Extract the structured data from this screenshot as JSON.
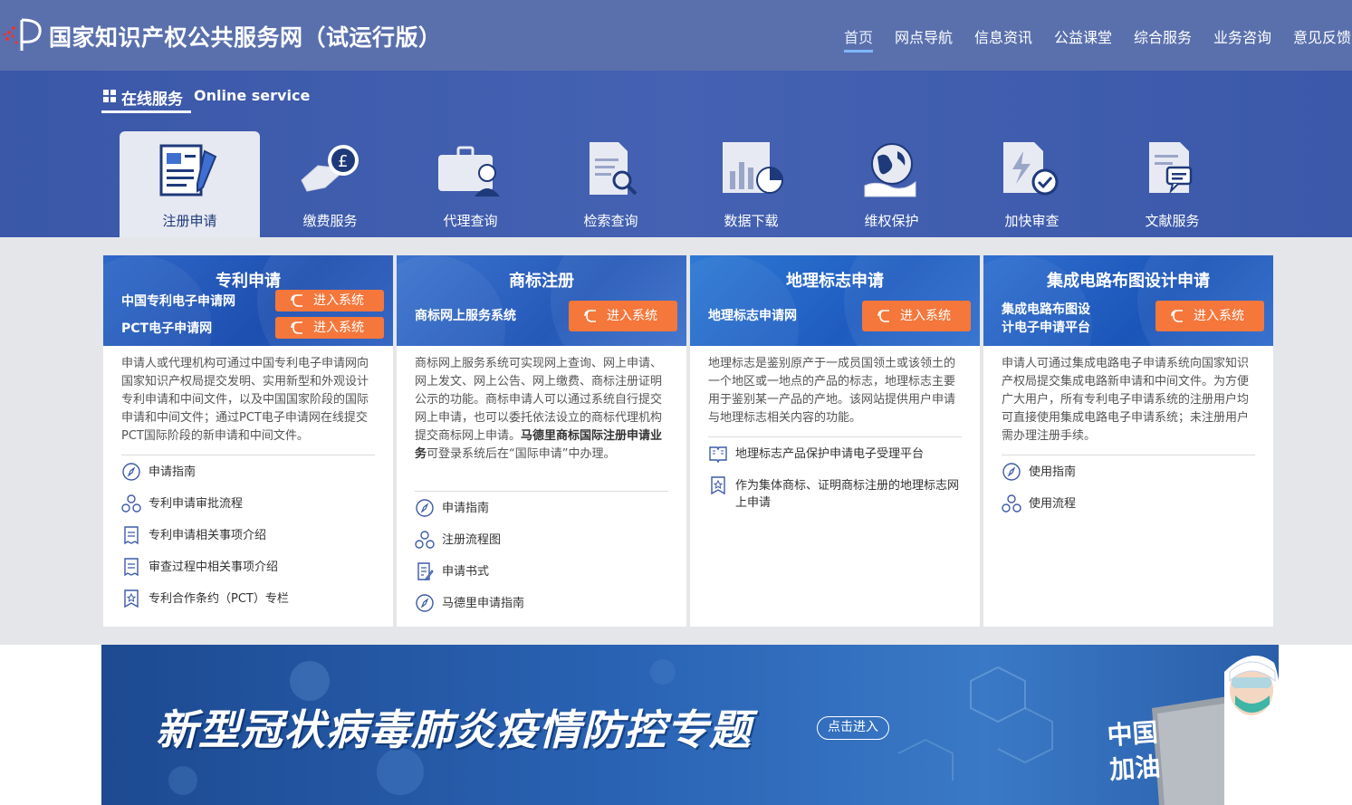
{
  "header": {
    "site_title": "国家知识产权公共服务网（试运行版）",
    "nav": [
      "首页",
      "网点导航",
      "信息资讯",
      "公益课堂",
      "综合服务",
      "业务咨询",
      "意见反馈"
    ],
    "active_nav": "首页"
  },
  "online_service": {
    "heading_cn": "在线服务",
    "heading_en": "Online service",
    "tabs": [
      {
        "label": "注册申请",
        "icon": "form-pen-icon",
        "active": true
      },
      {
        "label": "缴费服务",
        "icon": "hand-coin-icon",
        "active": false
      },
      {
        "label": "代理查询",
        "icon": "briefcase-person-icon",
        "active": false
      },
      {
        "label": "检索查询",
        "icon": "document-search-icon",
        "active": false
      },
      {
        "label": "数据下载",
        "icon": "bar-chart-icon",
        "active": false
      },
      {
        "label": "维权保护",
        "icon": "globe-hand-icon",
        "active": false
      },
      {
        "label": "加快审查",
        "icon": "lightning-check-icon",
        "active": false
      },
      {
        "label": "文献服务",
        "icon": "document-chat-icon",
        "active": false
      }
    ]
  },
  "cards": [
    {
      "title": "专利申请",
      "systems": [
        {
          "name": "中国专利电子申请网",
          "button": "进入系统"
        },
        {
          "name": "PCT电子申请网",
          "button": "进入系统"
        }
      ],
      "description": "申请人或代理机构可通过中国专利电子申请网向国家知识产权局提交发明、实用新型和外观设计专利申请和中间文件，以及中国国家阶段的国际申请和中间文件；通过PCT电子申请网在线提交PCT国际阶段的新申请和中间文件。",
      "links": [
        {
          "label": "申请指南",
          "icon": "compass-icon"
        },
        {
          "label": "专利申请审批流程",
          "icon": "flow-nodes-icon"
        },
        {
          "label": "专利申请相关事项介绍",
          "icon": "receipt-icon"
        },
        {
          "label": "审查过程中相关事项介绍",
          "icon": "receipt-icon"
        },
        {
          "label": "专利合作条约（PCT）专栏",
          "icon": "bookmark-icon"
        }
      ]
    },
    {
      "title": "商标注册",
      "systems": [
        {
          "name": "商标网上服务系统",
          "button": "进入系统"
        }
      ],
      "description_parts": {
        "before": "商标网上服务系统可实现网上查询、网上申请、网上发文、网上公告、网上缴费、商标注册证明公示的功能。商标申请人可以通过系统自行提交网上申请，也可以委托依法设立的商标代理机构提交商标网上申请。",
        "bold": "马德里商标国际注册申请业务",
        "after": "可登录系统后在“国际申请”中办理。"
      },
      "links": [
        {
          "label": "申请指南",
          "icon": "compass-icon"
        },
        {
          "label": "注册流程图",
          "icon": "flow-nodes-icon"
        },
        {
          "label": "申请书式",
          "icon": "document-edit-icon"
        },
        {
          "label": "马德里申请指南",
          "icon": "compass-icon"
        }
      ]
    },
    {
      "title": "地理标志申请",
      "systems": [
        {
          "name": "地理标志申请网",
          "button": "进入系统"
        }
      ],
      "description": "地理标志是鉴别原产于一成员国领土或该领土的一个地区或一地点的产品的标志，地理标志主要用于鉴别某一产品的产地。该网站提供用户申请与地理标志相关内容的功能。",
      "links": [
        {
          "label": "地理标志产品保护申请电子受理平台",
          "icon": "open-book-icon"
        },
        {
          "label": "作为集体商标、证明商标注册的地理标志网上申请",
          "icon": "bookmark-icon"
        }
      ]
    },
    {
      "title": "集成电路布图设计申请",
      "systems": [
        {
          "name": "集成电路布图设计电子申请平台",
          "name_line1": "集成电路布图设",
          "name_line2": "计电子申请平台",
          "button": "进入系统"
        }
      ],
      "description": "申请人可通过集成电路电子申请系统向国家知识产权局提交集成电路新申请和中间文件。为方便广大用户，所有专利电子申请系统的注册用户均可直接使用集成电路电子申请系统；未注册用户需办理注册手续。",
      "links": [
        {
          "label": "使用指南",
          "icon": "compass-icon"
        },
        {
          "label": "使用流程",
          "icon": "flow-nodes-icon"
        }
      ]
    }
  ],
  "banner": {
    "title": "新型冠状病毒肺炎疫情防控专题",
    "button": "点击进入",
    "sign_text": "中国加油",
    "sign_line1": "中国",
    "sign_line2": "加油"
  },
  "colors": {
    "header_bg": "#5a70ad",
    "service_bg": "#4461b2",
    "accent_orange": "#f5773b",
    "card_head_blue": "#2a5fbf",
    "panel_gray": "#e5e6ea"
  }
}
